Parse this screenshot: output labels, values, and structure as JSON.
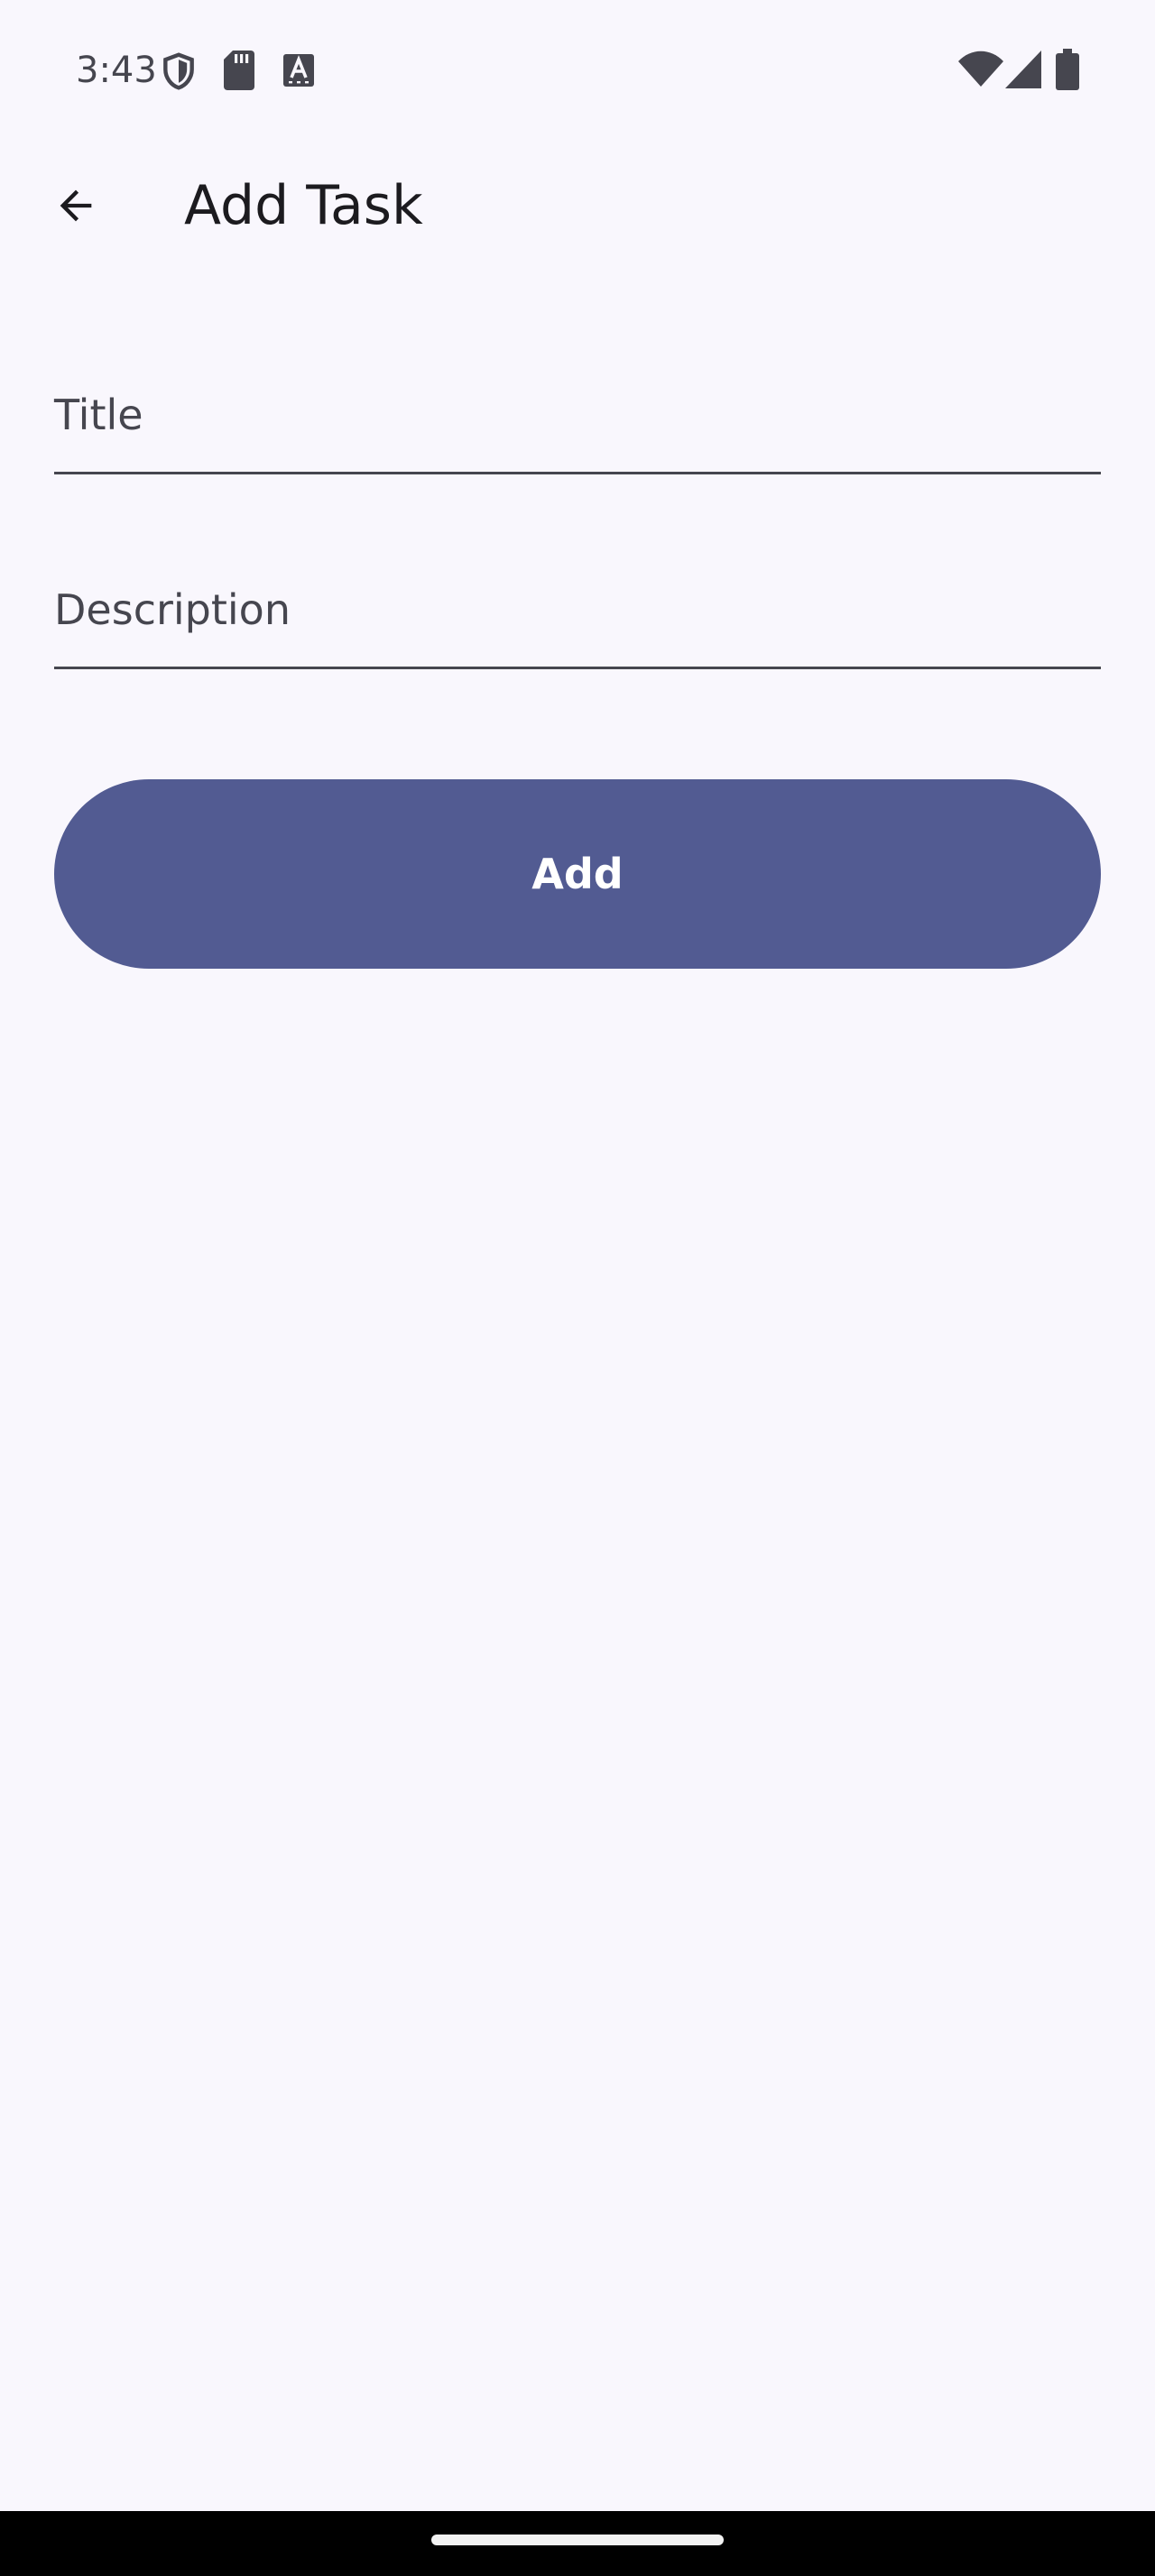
{
  "status_bar": {
    "time": "3:43",
    "left_icons": [
      "shield-icon",
      "sd-card-icon",
      "keyboard-a-icon"
    ],
    "right_icons": [
      "wifi-icon",
      "cell-signal-icon",
      "battery-icon"
    ]
  },
  "app_bar": {
    "title": "Add Task",
    "back_icon": "arrow-back-icon"
  },
  "form": {
    "title_field": {
      "label": "Title",
      "value": ""
    },
    "description_field": {
      "label": "Description",
      "value": ""
    },
    "add_button_label": "Add"
  },
  "colors": {
    "background": "#f9f7fd",
    "primary": "#525b92",
    "on_surface": "#1c1b1f",
    "on_surface_variant": "#46464f",
    "nav_bar": "#000000"
  }
}
